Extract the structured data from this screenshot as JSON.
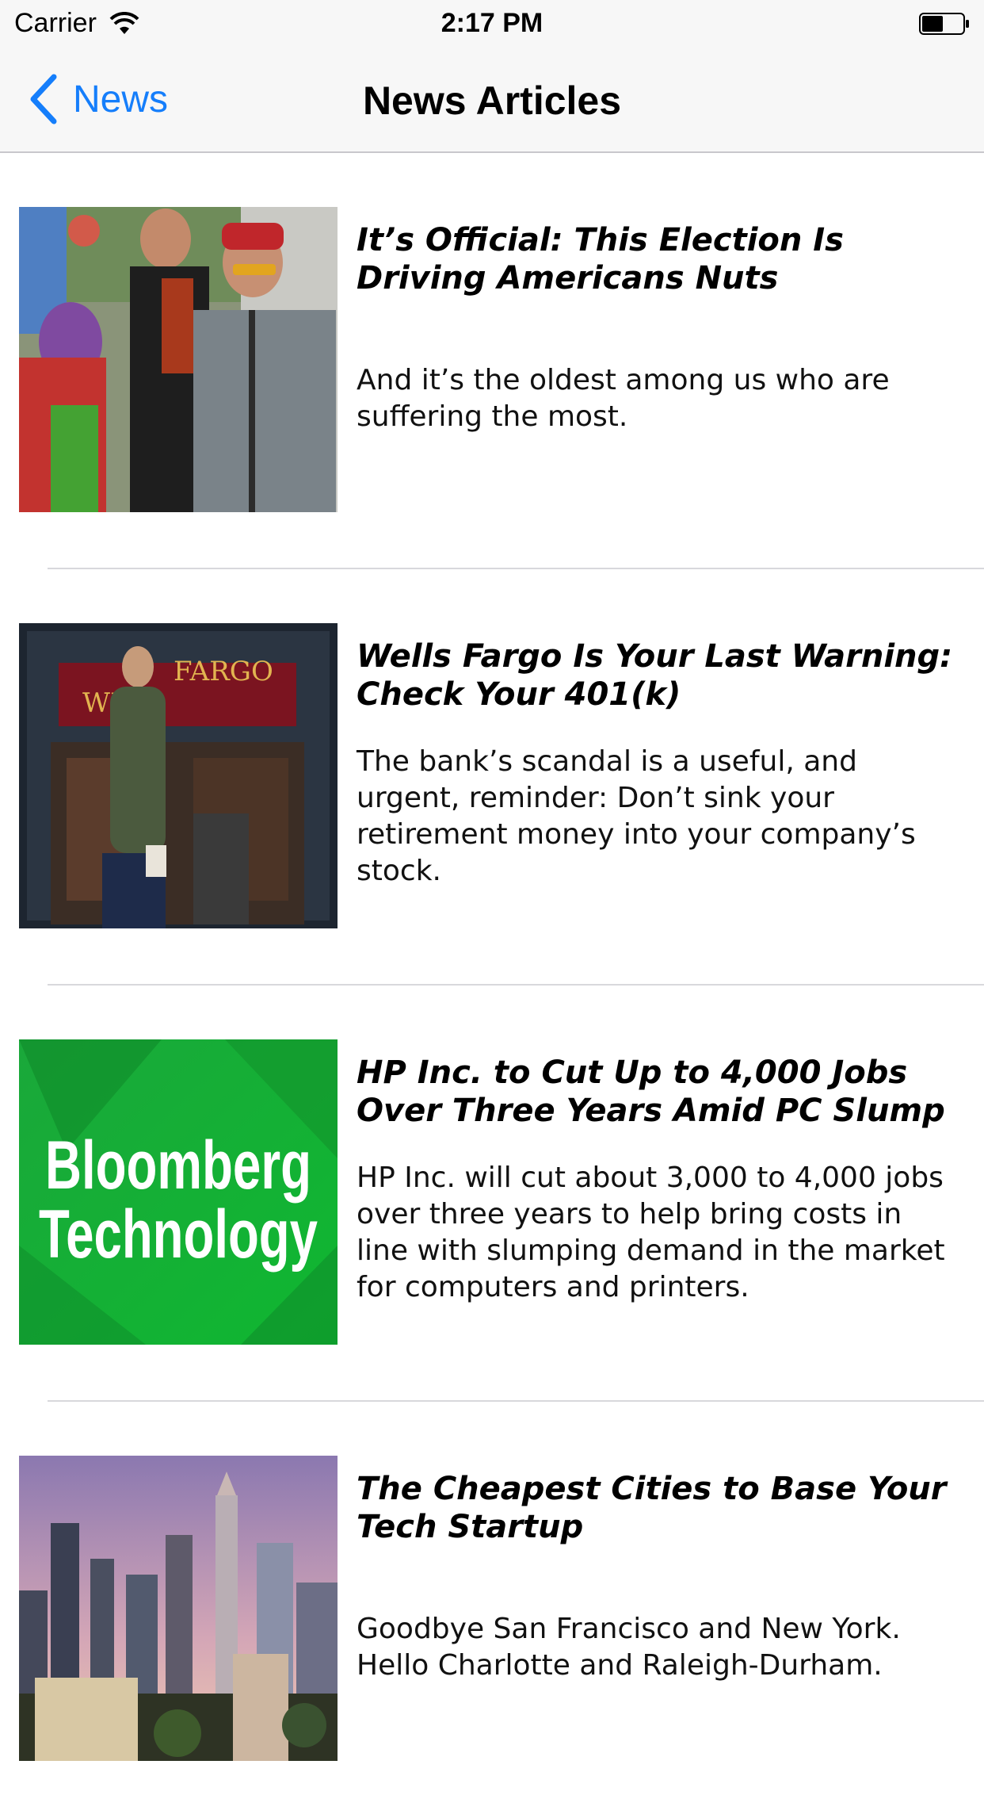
{
  "status_bar": {
    "carrier": "Carrier",
    "time": "2:17 PM"
  },
  "nav": {
    "back_label": "News",
    "title": "News Articles",
    "accent_color": "#157efb"
  },
  "articles": [
    {
      "headline": "It’s Official: This Election Is Driving Americans Nuts",
      "summary": "And it’s the oldest among us who are suffering the most.",
      "image": "protest-photo"
    },
    {
      "headline": "Wells Fargo Is Your Last Warning: Check Your 401(k)",
      "summary": "The bank’s scandal is a useful, and urgent, reminder: Don’t sink your retirement money into your company’s stock.",
      "image": "wells-fargo-branch-photo",
      "image_text": [
        "WE",
        "FARGO"
      ]
    },
    {
      "headline": "HP Inc. to Cut Up to 4,000 Jobs Over Three Years Amid PC Slump",
      "summary": "HP Inc. will cut about 3,000 to 4,000 jobs over three years to help bring costs in line with slumping demand in the market for computers and printers.",
      "image": "bloomberg-technology-logo",
      "image_text": [
        "Bloomberg",
        "Technology"
      ]
    },
    {
      "headline": "The Cheapest Cities to Base Your Tech Startup",
      "summary": "Goodbye San Francisco and New York. Hello Charlotte and Raleigh-Durham.",
      "image": "city-skyline-photo"
    }
  ]
}
